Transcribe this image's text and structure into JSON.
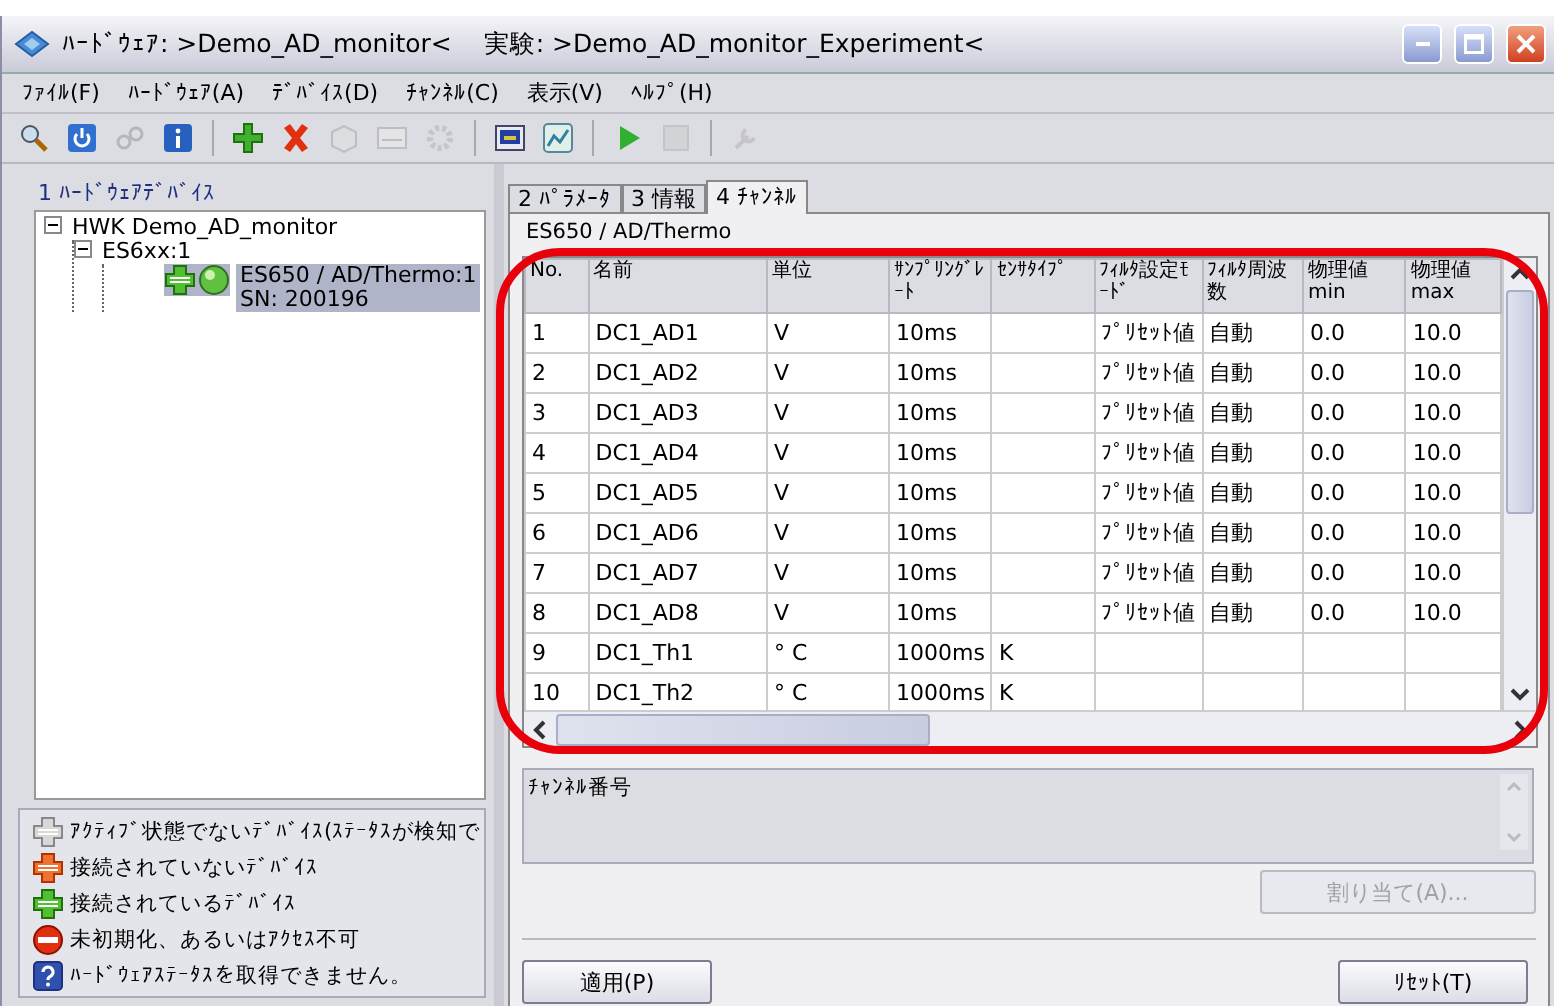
{
  "window": {
    "title_parts": [
      "ﾊｰﾄﾞｳｪｱ: >Demo_AD_monitor<",
      "実験: >Demo_AD_monitor_Experiment<"
    ]
  },
  "menu": [
    "ﾌｧｲﾙ(F)",
    "ﾊｰﾄﾞｳｪｱ(A)",
    "ﾃﾞﾊﾞｲｽ(D)",
    "ﾁｬﾝﾈﾙ(C)",
    "表示(V)",
    "ﾍﾙﾌﾟ(H)"
  ],
  "toolbar": [
    {
      "kind": "search",
      "disabled": false
    },
    {
      "kind": "power",
      "disabled": false
    },
    {
      "kind": "link",
      "disabled": true
    },
    {
      "kind": "info",
      "disabled": false
    },
    {
      "kind": "separator"
    },
    {
      "kind": "add",
      "disabled": false
    },
    {
      "kind": "delete",
      "disabled": false
    },
    {
      "kind": "box",
      "disabled": true
    },
    {
      "kind": "card",
      "disabled": true
    },
    {
      "kind": "gear",
      "disabled": true
    },
    {
      "kind": "separator"
    },
    {
      "kind": "monitor",
      "disabled": false
    },
    {
      "kind": "chart",
      "disabled": false
    },
    {
      "kind": "separator"
    },
    {
      "kind": "play",
      "disabled": false
    },
    {
      "kind": "stop",
      "disabled": true
    },
    {
      "kind": "separator"
    },
    {
      "kind": "tool",
      "disabled": true
    }
  ],
  "device_panel": {
    "title": "1 ﾊｰﾄﾞｳｪｱﾃﾞﾊﾞｲｽ",
    "tree": [
      {
        "lines": [
          "HWK Demo_AD_monitor"
        ],
        "expanded": true,
        "selected": false,
        "children": [
          {
            "lines": [
              "ES6xx:1"
            ],
            "expanded": true,
            "selected": false,
            "children": [
              {
                "lines": [
                  "ES650 / AD/Thermo:1",
                  "SN: 200196"
                ],
                "kind": "connected",
                "selected": true
              }
            ]
          }
        ]
      }
    ],
    "legend": [
      {
        "kind": "inactive",
        "label": "ｱｸﾃｨﾌﾞ状態でないﾃﾞﾊﾞｲｽ(ｽﾃｰﾀｽが検知で"
      },
      {
        "kind": "disconnected",
        "label": "接続されていないﾃﾞﾊﾞｲｽ"
      },
      {
        "kind": "connected",
        "label": "接続されているﾃﾞﾊﾞｲｽ"
      },
      {
        "kind": "uninitialized",
        "label": "未初期化、あるいはｱｸｾｽ不可"
      },
      {
        "kind": "unknown",
        "label": "ﾊｰﾄﾞｳｪｱｽﾃｰﾀｽを取得できません。"
      }
    ]
  },
  "tabs": [
    {
      "label": "2 ﾊﾟﾗﾒｰﾀ",
      "selected": false
    },
    {
      "label": "3 情報",
      "selected": false
    },
    {
      "label": "4 ﾁｬﾝﾈﾙ",
      "selected": true
    }
  ],
  "group_label": "ES650 / AD/Thermo",
  "table": {
    "columns": [
      "No.",
      "名前",
      "単位",
      "ｻﾝﾌﾟﾘﾝｸﾞﾚｰﾄ",
      "ｾﾝｻﾀｲﾌﾟ",
      "ﾌｨﾙﾀ設定ﾓｰﾄﾞ",
      "ﾌｨﾙﾀ周波数",
      "物理値\nmin",
      "物理値\nmax"
    ],
    "rows": [
      [
        "1",
        "DC1_AD1",
        "V",
        "10ms",
        null,
        "ﾌﾟﾘｾｯﾄ値",
        "自動",
        "0.0",
        "10.0"
      ],
      [
        "2",
        "DC1_AD2",
        "V",
        "10ms",
        null,
        "ﾌﾟﾘｾｯﾄ値",
        "自動",
        "0.0",
        "10.0"
      ],
      [
        "3",
        "DC1_AD3",
        "V",
        "10ms",
        null,
        "ﾌﾟﾘｾｯﾄ値",
        "自動",
        "0.0",
        "10.0"
      ],
      [
        "4",
        "DC1_AD4",
        "V",
        "10ms",
        null,
        "ﾌﾟﾘｾｯﾄ値",
        "自動",
        "0.0",
        "10.0"
      ],
      [
        "5",
        "DC1_AD5",
        "V",
        "10ms",
        null,
        "ﾌﾟﾘｾｯﾄ値",
        "自動",
        "0.0",
        "10.0"
      ],
      [
        "6",
        "DC1_AD6",
        "V",
        "10ms",
        null,
        "ﾌﾟﾘｾｯﾄ値",
        "自動",
        "0.0",
        "10.0"
      ],
      [
        "7",
        "DC1_AD7",
        "V",
        "10ms",
        null,
        "ﾌﾟﾘｾｯﾄ値",
        "自動",
        "0.0",
        "10.0"
      ],
      [
        "8",
        "DC1_AD8",
        "V",
        "10ms",
        null,
        "ﾌﾟﾘｾｯﾄ値",
        "自動",
        "0.0",
        "10.0"
      ],
      [
        "9",
        "DC1_Th1",
        "° C",
        "1000ms",
        "K",
        null,
        null,
        null,
        null
      ],
      [
        "10",
        "DC1_Th2",
        "° C",
        "1000ms",
        "K",
        null,
        null,
        null,
        null
      ]
    ]
  },
  "description": "ﾁｬﾝﾈﾙ番号",
  "buttons": {
    "assign": {
      "label": "割り当て(A)...",
      "disabled": true
    },
    "apply": {
      "label": "適用(P)",
      "disabled": false
    },
    "reset": {
      "label": "ﾘｾｯﾄ(T)",
      "disabled": false
    }
  }
}
